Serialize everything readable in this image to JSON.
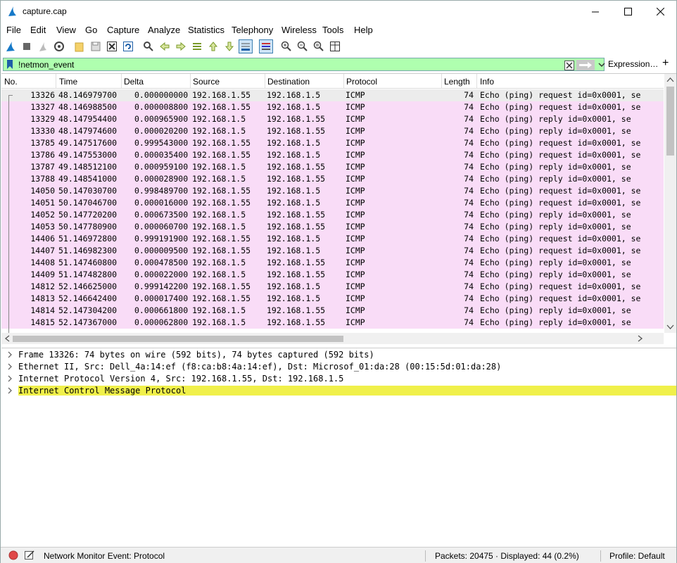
{
  "window": {
    "title": "capture.cap"
  },
  "menu": [
    "File",
    "Edit",
    "View",
    "Go",
    "Capture",
    "Analyze",
    "Statistics",
    "Telephony",
    "Wireless",
    "Tools",
    "Help"
  ],
  "toolbar": {
    "icons": [
      "shark-fin-start-icon",
      "stop-icon",
      "restart-icon",
      "options-gear-icon",
      "open-folder-icon",
      "save-icon",
      "close-file-icon",
      "reload-icon",
      "find-icon",
      "go-back-icon",
      "go-forward-icon",
      "go-to-packet-icon",
      "go-first-icon",
      "go-last-icon",
      "autoscroll-icon",
      "colorize-icon",
      "zoom-in-icon",
      "zoom-out-icon",
      "zoom-reset-icon",
      "resize-columns-icon"
    ]
  },
  "filter": {
    "value": "!netmon_event",
    "expression_label": "Expression…",
    "plus_label": "+"
  },
  "columns": [
    "No.",
    "Time",
    "Delta",
    "Source",
    "Destination",
    "Protocol",
    "Length",
    "Info"
  ],
  "packets": [
    {
      "no": "13326",
      "time": "48.146979700",
      "delta": "0.000000000",
      "src": "192.168.1.55",
      "dst": "192.168.1.5",
      "proto": "ICMP",
      "len": "74",
      "info": "Echo (ping) request  id=0x0001, se"
    },
    {
      "no": "13327",
      "time": "48.146988500",
      "delta": "0.000008800",
      "src": "192.168.1.55",
      "dst": "192.168.1.5",
      "proto": "ICMP",
      "len": "74",
      "info": "Echo (ping) request  id=0x0001, se"
    },
    {
      "no": "13329",
      "time": "48.147954400",
      "delta": "0.000965900",
      "src": "192.168.1.5",
      "dst": "192.168.1.55",
      "proto": "ICMP",
      "len": "74",
      "info": "Echo (ping) reply    id=0x0001, se"
    },
    {
      "no": "13330",
      "time": "48.147974600",
      "delta": "0.000020200",
      "src": "192.168.1.5",
      "dst": "192.168.1.55",
      "proto": "ICMP",
      "len": "74",
      "info": "Echo (ping) reply    id=0x0001, se"
    },
    {
      "no": "13785",
      "time": "49.147517600",
      "delta": "0.999543000",
      "src": "192.168.1.55",
      "dst": "192.168.1.5",
      "proto": "ICMP",
      "len": "74",
      "info": "Echo (ping) request  id=0x0001, se"
    },
    {
      "no": "13786",
      "time": "49.147553000",
      "delta": "0.000035400",
      "src": "192.168.1.55",
      "dst": "192.168.1.5",
      "proto": "ICMP",
      "len": "74",
      "info": "Echo (ping) request  id=0x0001, se"
    },
    {
      "no": "13787",
      "time": "49.148512100",
      "delta": "0.000959100",
      "src": "192.168.1.5",
      "dst": "192.168.1.55",
      "proto": "ICMP",
      "len": "74",
      "info": "Echo (ping) reply    id=0x0001, se"
    },
    {
      "no": "13788",
      "time": "49.148541000",
      "delta": "0.000028900",
      "src": "192.168.1.5",
      "dst": "192.168.1.55",
      "proto": "ICMP",
      "len": "74",
      "info": "Echo (ping) reply    id=0x0001, se"
    },
    {
      "no": "14050",
      "time": "50.147030700",
      "delta": "0.998489700",
      "src": "192.168.1.55",
      "dst": "192.168.1.5",
      "proto": "ICMP",
      "len": "74",
      "info": "Echo (ping) request  id=0x0001, se"
    },
    {
      "no": "14051",
      "time": "50.147046700",
      "delta": "0.000016000",
      "src": "192.168.1.55",
      "dst": "192.168.1.5",
      "proto": "ICMP",
      "len": "74",
      "info": "Echo (ping) request  id=0x0001, se"
    },
    {
      "no": "14052",
      "time": "50.147720200",
      "delta": "0.000673500",
      "src": "192.168.1.5",
      "dst": "192.168.1.55",
      "proto": "ICMP",
      "len": "74",
      "info": "Echo (ping) reply    id=0x0001, se"
    },
    {
      "no": "14053",
      "time": "50.147780900",
      "delta": "0.000060700",
      "src": "192.168.1.5",
      "dst": "192.168.1.55",
      "proto": "ICMP",
      "len": "74",
      "info": "Echo (ping) reply    id=0x0001, se"
    },
    {
      "no": "14406",
      "time": "51.146972800",
      "delta": "0.999191900",
      "src": "192.168.1.55",
      "dst": "192.168.1.5",
      "proto": "ICMP",
      "len": "74",
      "info": "Echo (ping) request  id=0x0001, se"
    },
    {
      "no": "14407",
      "time": "51.146982300",
      "delta": "0.000009500",
      "src": "192.168.1.55",
      "dst": "192.168.1.5",
      "proto": "ICMP",
      "len": "74",
      "info": "Echo (ping) request  id=0x0001, se"
    },
    {
      "no": "14408",
      "time": "51.147460800",
      "delta": "0.000478500",
      "src": "192.168.1.5",
      "dst": "192.168.1.55",
      "proto": "ICMP",
      "len": "74",
      "info": "Echo (ping) reply    id=0x0001, se"
    },
    {
      "no": "14409",
      "time": "51.147482800",
      "delta": "0.000022000",
      "src": "192.168.1.5",
      "dst": "192.168.1.55",
      "proto": "ICMP",
      "len": "74",
      "info": "Echo (ping) reply    id=0x0001, se"
    },
    {
      "no": "14812",
      "time": "52.146625000",
      "delta": "0.999142200",
      "src": "192.168.1.55",
      "dst": "192.168.1.5",
      "proto": "ICMP",
      "len": "74",
      "info": "Echo (ping) request  id=0x0001, se"
    },
    {
      "no": "14813",
      "time": "52.146642400",
      "delta": "0.000017400",
      "src": "192.168.1.55",
      "dst": "192.168.1.5",
      "proto": "ICMP",
      "len": "74",
      "info": "Echo (ping) request  id=0x0001, se"
    },
    {
      "no": "14814",
      "time": "52.147304200",
      "delta": "0.000661800",
      "src": "192.168.1.5",
      "dst": "192.168.1.55",
      "proto": "ICMP",
      "len": "74",
      "info": "Echo (ping) reply    id=0x0001, se"
    },
    {
      "no": "14815",
      "time": "52.147367000",
      "delta": "0.000062800",
      "src": "192.168.1.5",
      "dst": "192.168.1.55",
      "proto": "ICMP",
      "len": "74",
      "info": "Echo (ping) reply    id=0x0001, se"
    }
  ],
  "details": [
    "Frame 13326: 74 bytes on wire (592 bits), 74 bytes captured (592 bits)",
    "Ethernet II, Src: Dell_4a:14:ef (f8:ca:b8:4a:14:ef), Dst: Microsof_01:da:28 (00:15:5d:01:da:28)",
    "Internet Protocol Version 4, Src: 192.168.1.55, Dst: 192.168.1.5",
    "Internet Control Message Protocol"
  ],
  "status": {
    "message": "Network Monitor Event: Protocol",
    "packets": "Packets: 20475 · Displayed: 44 (0.2%)",
    "profile": "Profile: Default"
  },
  "colors": {
    "row_bg": "#f9dcf7",
    "filter_bg": "#afffaf",
    "highlight": "#f0f04a"
  }
}
